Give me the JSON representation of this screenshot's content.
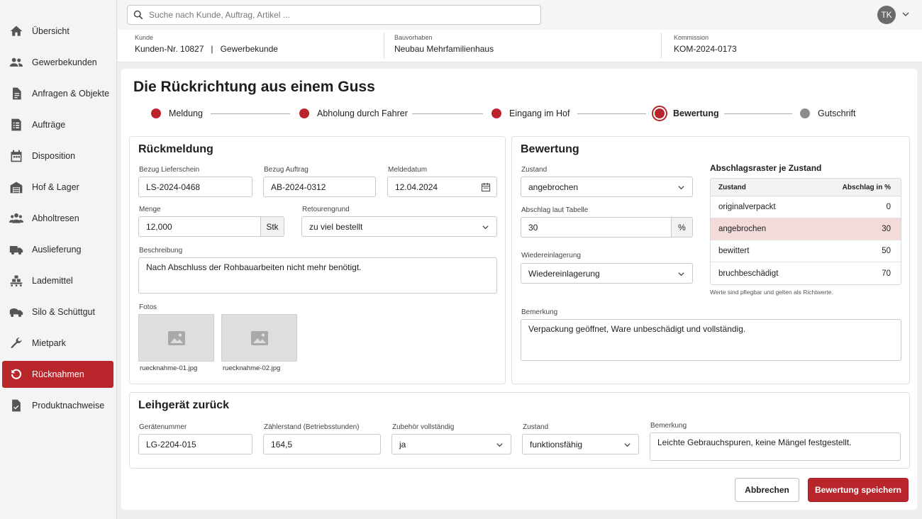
{
  "sidebar": {
    "items": [
      {
        "label": "Übersicht",
        "icon": "home-icon",
        "active": false
      },
      {
        "label": "Gewerbekunden",
        "icon": "users-icon",
        "active": false
      },
      {
        "label": "Anfragen & Objekte",
        "icon": "document-icon",
        "active": false
      },
      {
        "label": "Aufträge",
        "icon": "list-icon",
        "active": false
      },
      {
        "label": "Disposition",
        "icon": "calendar-icon",
        "active": false
      },
      {
        "label": "Hof & Lager",
        "icon": "warehouse-icon",
        "active": false
      },
      {
        "label": "Abholtresen",
        "icon": "people-icon",
        "active": false
      },
      {
        "label": "Auslieferung",
        "icon": "truck-icon",
        "active": false
      },
      {
        "label": "Lademittel",
        "icon": "pallet-icon",
        "active": false
      },
      {
        "label": "Silo & Schüttgut",
        "icon": "silo-truck-icon",
        "active": false
      },
      {
        "label": "Mietpark",
        "icon": "wrench-icon",
        "active": false
      },
      {
        "label": "Rücknahmen",
        "icon": "return-icon",
        "active": true
      },
      {
        "label": "Produktnachweise",
        "icon": "doc-check-icon",
        "active": false
      }
    ]
  },
  "topbar": {
    "search_placeholder": "Suche nach Kunde, Auftrag, Artikel ...",
    "avatar_initials": "TK"
  },
  "context": {
    "kunde_label": "Kunde",
    "kunde_nr": "Kunden-Nr. 10827",
    "separator": "|",
    "kunde_typ": "Gewerbekunde",
    "bauvorhaben_label": "Bauvorhaben",
    "bauvorhaben_value": "Neubau Mehrfamilienhaus",
    "kommission_label": "Kommission",
    "kommission_value": "KOM-2024-0173"
  },
  "page": {
    "title": "Die Rückrichtung aus einem Guss"
  },
  "stepper": [
    {
      "label": "Meldung",
      "state": "done"
    },
    {
      "label": "Abholung durch Fahrer",
      "state": "done"
    },
    {
      "label": "Eingang im Hof",
      "state": "done"
    },
    {
      "label": "Bewertung",
      "state": "current"
    },
    {
      "label": "Gutschrift",
      "state": "pending"
    }
  ],
  "rueckmeldung": {
    "title": "Rückmeldung",
    "lieferschein_label": "Bezug Lieferschein",
    "lieferschein_value": "LS-2024-0468",
    "auftrag_label": "Bezug Auftrag",
    "auftrag_value": "AB-2024-0312",
    "meldedatum_label": "Meldedatum",
    "meldedatum_value": "12.04.2024",
    "menge_label": "Menge",
    "menge_value": "12,000",
    "menge_unit": "Stk",
    "retourengrund_label": "Retourengrund",
    "retourengrund_value": "zu viel bestellt",
    "beschreibung_label": "Beschreibung",
    "beschreibung_value": "Nach Abschluss der Rohbauarbeiten nicht mehr benötigt.",
    "fotos_label": "Fotos",
    "fotos": [
      "ruecknahme-01.jpg",
      "ruecknahme-02.jpg"
    ]
  },
  "bewertung": {
    "title": "Bewertung",
    "zustand_label": "Zustand",
    "zustand_value": "angebrochen",
    "abschlag_label": "Abschlag laut Tabelle",
    "abschlag_value": "30",
    "abschlag_unit": "%",
    "wiedereinlagerung_label": "Wiedereinlagerung",
    "wiedereinlagerung_value": "Wiedereinlagerung",
    "bemerkung_label": "Bemerkung",
    "bemerkung_value": "Verpackung geöffnet, Ware unbeschädigt und vollständig.",
    "raster": {
      "title": "Abschlagsraster je Zustand",
      "col_zustand": "Zustand",
      "col_abschlag": "Abschlag in %",
      "rows": [
        {
          "zustand": "originalverpackt",
          "abschlag": "0",
          "highlight": false
        },
        {
          "zustand": "angebrochen",
          "abschlag": "30",
          "highlight": true
        },
        {
          "zustand": "bewittert",
          "abschlag": "50",
          "highlight": false
        },
        {
          "zustand": "bruchbeschädigt",
          "abschlag": "70",
          "highlight": false
        }
      ],
      "note": "Werte sind pflegbar und gelten als Richtwerte."
    }
  },
  "leihgeraet": {
    "title": "Leihgerät zurück",
    "geraetenummer_label": "Gerätenummer",
    "geraetenummer_value": "LG-2204-015",
    "zaehlerstand_label": "Zählerstand (Betriebsstunden)",
    "zaehlerstand_value": "164,5",
    "zubehoer_label": "Zubehör vollständig",
    "zubehoer_value": "ja",
    "zustand_label": "Zustand",
    "zustand_value": "funktionsfähig",
    "bemerkung_label": "Bemerkung",
    "bemerkung_value": "Leichte Gebrauchspuren, keine Mängel festgestellt."
  },
  "actions": {
    "cancel_label": "Abbrechen",
    "save_label": "Bewertung speichern"
  },
  "colors": {
    "accent": "#b8262c",
    "highlight_row": "#f2dbd9",
    "pending_step": "#8c8c8c"
  }
}
